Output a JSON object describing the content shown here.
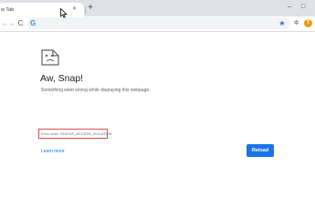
{
  "tab": {
    "title": "w Tab",
    "close_icon": "close-icon"
  },
  "new_tab_icon": "+",
  "window": {
    "minimize": "–",
    "maximize": "□"
  },
  "toolbar": {
    "back": "←",
    "forward": "→",
    "reload": "C"
  },
  "omnibox": {
    "google_icon": "G",
    "value": "",
    "bookmark_icon": "★"
  },
  "extensions_icon": "puzzle-icon",
  "profile": {
    "initial": "T",
    "color": "#f29900"
  },
  "error": {
    "heading": "Aw, Snap!",
    "message": "Something went wrong while displaying this webpage.",
    "code": "Error code: STATUS_ACCESS_VIOLATION",
    "learn_more": "Learn more",
    "reload": "Reload"
  },
  "colors": {
    "accent": "#1a73e8",
    "highlight_box": "#d94f4f"
  }
}
